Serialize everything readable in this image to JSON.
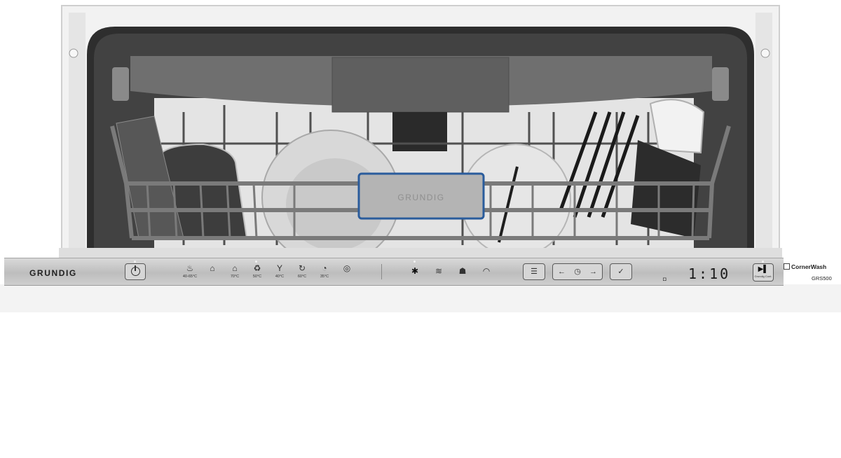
{
  "appliance": {
    "brand": "GRUNDIG",
    "basket_logo": "GRUNDIG",
    "model": "GRS500",
    "feature": "CornerWash",
    "display_time": "1:10",
    "start_sublabel": "Grundig Cont."
  },
  "programs": [
    {
      "icon": "pot-icon",
      "glyph": "♨",
      "temp": "40-65°C"
    },
    {
      "icon": "auto-icon",
      "glyph": "⌂",
      "temp": ""
    },
    {
      "icon": "intensive-icon",
      "glyph": "⌂",
      "temp": "70°C"
    },
    {
      "icon": "eco-icon",
      "glyph": "♻",
      "temp": "50°C"
    },
    {
      "icon": "glass-icon",
      "glyph": "Y",
      "temp": "40°C"
    },
    {
      "icon": "quick-icon",
      "glyph": "↻",
      "temp": "60°C"
    },
    {
      "icon": "mini-icon",
      "glyph": "◔",
      "temp": "35°C"
    },
    {
      "icon": "prewash-icon",
      "glyph": "◎",
      "temp": ""
    }
  ],
  "options": [
    {
      "icon": "steam-icon",
      "glyph": "✱"
    },
    {
      "icon": "half-load-icon",
      "glyph": "≋"
    },
    {
      "icon": "shine-icon",
      "glyph": "☗"
    },
    {
      "icon": "extra-dry-icon",
      "glyph": "◠"
    }
  ],
  "controls": {
    "menu_glyph": "☰",
    "delay_left": "←",
    "delay_clock": "◷",
    "delay_right": "→",
    "check_glyph": "✓",
    "play_glyph": "▶▌"
  },
  "colors": {
    "panel": "#c7c7c7",
    "tub_interior": "#3b3b3b",
    "rack_wire": "#6e6e6e",
    "basket_handle_border": "#2a5c9c",
    "door": "#ffffff"
  }
}
